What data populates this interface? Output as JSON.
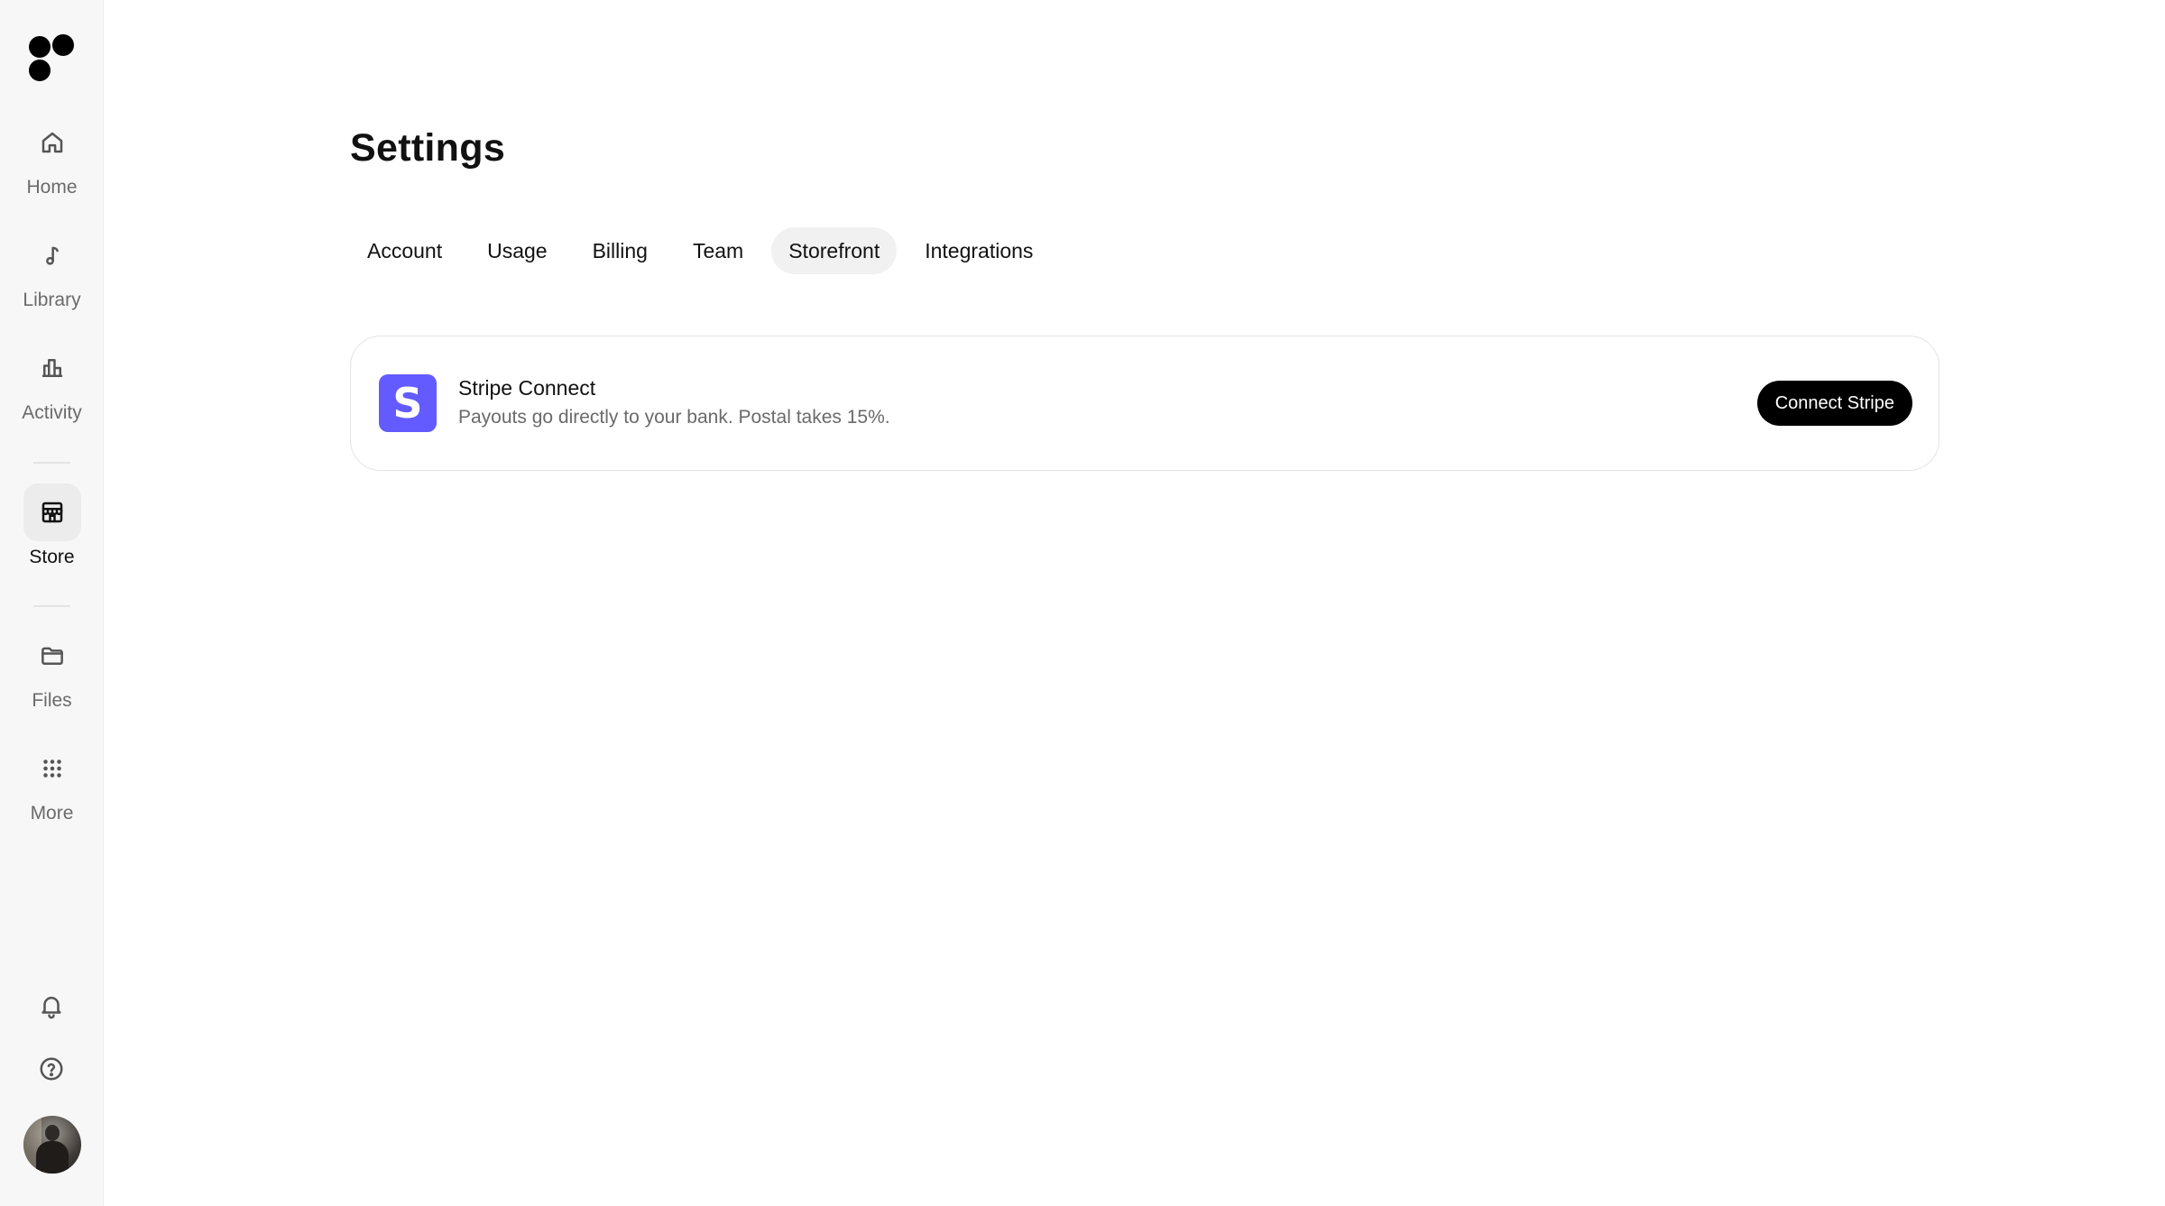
{
  "sidebar": {
    "logo": "logo-dots",
    "items": [
      {
        "label": "Home",
        "icon": "home-icon"
      },
      {
        "label": "Library",
        "icon": "music-note-icon"
      },
      {
        "label": "Activity",
        "icon": "bar-chart-icon"
      },
      {
        "label": "Store",
        "icon": "store-icon",
        "active": true
      },
      {
        "label": "Files",
        "icon": "folder-icon"
      },
      {
        "label": "More",
        "icon": "grid-dots-icon"
      }
    ],
    "bottom": [
      {
        "icon": "bell-icon"
      },
      {
        "icon": "help-circle-icon"
      },
      {
        "icon": "user-avatar"
      }
    ]
  },
  "main": {
    "title": "Settings",
    "tabs": [
      {
        "label": "Account"
      },
      {
        "label": "Usage"
      },
      {
        "label": "Billing"
      },
      {
        "label": "Team"
      },
      {
        "label": "Storefront",
        "active": true
      },
      {
        "label": "Integrations"
      }
    ],
    "stripe_card": {
      "logo_letter": "S",
      "title": "Stripe Connect",
      "description": "Payouts go directly to your bank. Postal takes 15%.",
      "button_label": "Connect Stripe"
    }
  },
  "colors": {
    "stripe_brand": "#635bff",
    "primary_button": "#000000",
    "active_tab_bg": "#f1f1f1",
    "sidebar_bg": "#f7f7f7"
  }
}
